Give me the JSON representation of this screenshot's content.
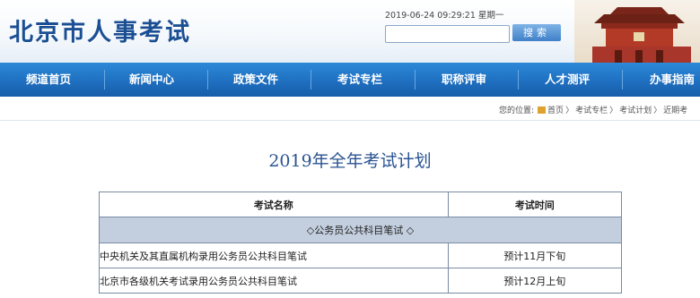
{
  "header": {
    "site_title": "北京市人事考试",
    "datetime": "2019-06-24 09:29:21 星期一",
    "search_button": "搜索",
    "search_placeholder": ""
  },
  "nav": {
    "items": [
      {
        "label": "频道首页"
      },
      {
        "label": "新闻中心"
      },
      {
        "label": "政策文件"
      },
      {
        "label": "考试专栏"
      },
      {
        "label": "职称评审"
      },
      {
        "label": "人才测评"
      },
      {
        "label": "办事指南"
      }
    ]
  },
  "breadcrumb": {
    "prefix": "您的位置:",
    "items": [
      "首页",
      "考试专栏",
      "考试计划",
      "近期考"
    ]
  },
  "page": {
    "title": "2019年全年考试计划"
  },
  "table": {
    "headers": [
      "考试名称",
      "考试时间"
    ],
    "category": "◇公务员公共科目笔试 ◇",
    "rows": [
      {
        "name": "中央机关及其直属机构录用公务员公共科目笔试",
        "time": "预计11月下旬"
      },
      {
        "name": "北京市各级机关考试录用公务员公共科目笔试",
        "time": "预计12月上旬"
      }
    ]
  },
  "colors": {
    "nav_blue": "#1f6fc0",
    "title_blue": "#2a5391",
    "category_bg": "#c3cfdf"
  }
}
